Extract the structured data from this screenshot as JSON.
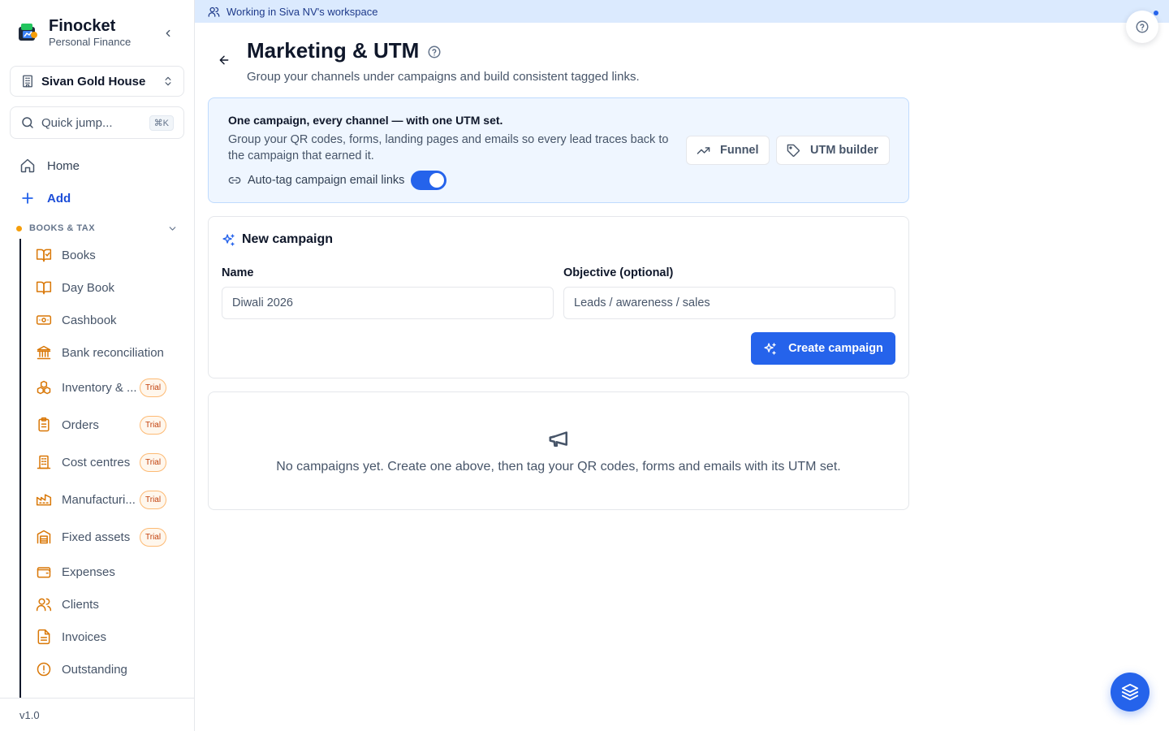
{
  "brand": {
    "name": "Finocket",
    "subtitle": "Personal Finance"
  },
  "workspace": {
    "name": "Sivan Gold House"
  },
  "quick_jump": {
    "label": "Quick jump...",
    "shortcut": "⌘K"
  },
  "nav": {
    "home": "Home",
    "add": "Add"
  },
  "section": {
    "title": "BOOKS & TAX"
  },
  "sub_items": [
    {
      "label": "Books",
      "icon": "book-check-icon"
    },
    {
      "label": "Day Book",
      "icon": "book-open-icon"
    },
    {
      "label": "Cashbook",
      "icon": "banknote-icon"
    },
    {
      "label": "Bank reconciliation",
      "icon": "landmark-icon"
    },
    {
      "label": "Inventory & ...",
      "icon": "boxes-icon",
      "badge": "Trial"
    },
    {
      "label": "Orders",
      "icon": "clipboard-list-icon",
      "badge": "Trial"
    },
    {
      "label": "Cost centres",
      "icon": "building-icon",
      "badge": "Trial"
    },
    {
      "label": "Manufacturi...",
      "icon": "factory-icon",
      "badge": "Trial"
    },
    {
      "label": "Fixed assets",
      "icon": "warehouse-icon",
      "badge": "Trial"
    },
    {
      "label": "Expenses",
      "icon": "wallet-icon"
    },
    {
      "label": "Clients",
      "icon": "users-icon"
    },
    {
      "label": "Invoices",
      "icon": "file-text-icon"
    },
    {
      "label": "Outstanding",
      "icon": "alert-circle-icon"
    }
  ],
  "version": "v1.0",
  "banner": {
    "text": "Working in Siva NV's workspace"
  },
  "page": {
    "title": "Marketing & UTM",
    "subtitle": "Group your channels under campaigns and build consistent tagged links."
  },
  "info": {
    "title": "One campaign, every channel — with one UTM set.",
    "description": "Group your QR codes, forms, landing pages and emails so every lead traces back to the campaign that earned it.",
    "autotag_label": "Auto-tag campaign email links",
    "autotag_enabled": true,
    "funnel_label": "Funnel",
    "utm_builder_label": "UTM builder"
  },
  "new_campaign": {
    "title": "New campaign",
    "name_label": "Name",
    "name_placeholder": "Diwali 2026",
    "objective_label": "Objective (optional)",
    "objective_placeholder": "Leads / awareness / sales",
    "create_label": "Create campaign"
  },
  "empty": {
    "text": "No campaigns yet. Create one above, then tag your QR codes, forms and emails with its UTM set."
  },
  "colors": {
    "accent": "#2563eb",
    "warning": "#f59e0b",
    "icon_orange": "#d97706"
  }
}
